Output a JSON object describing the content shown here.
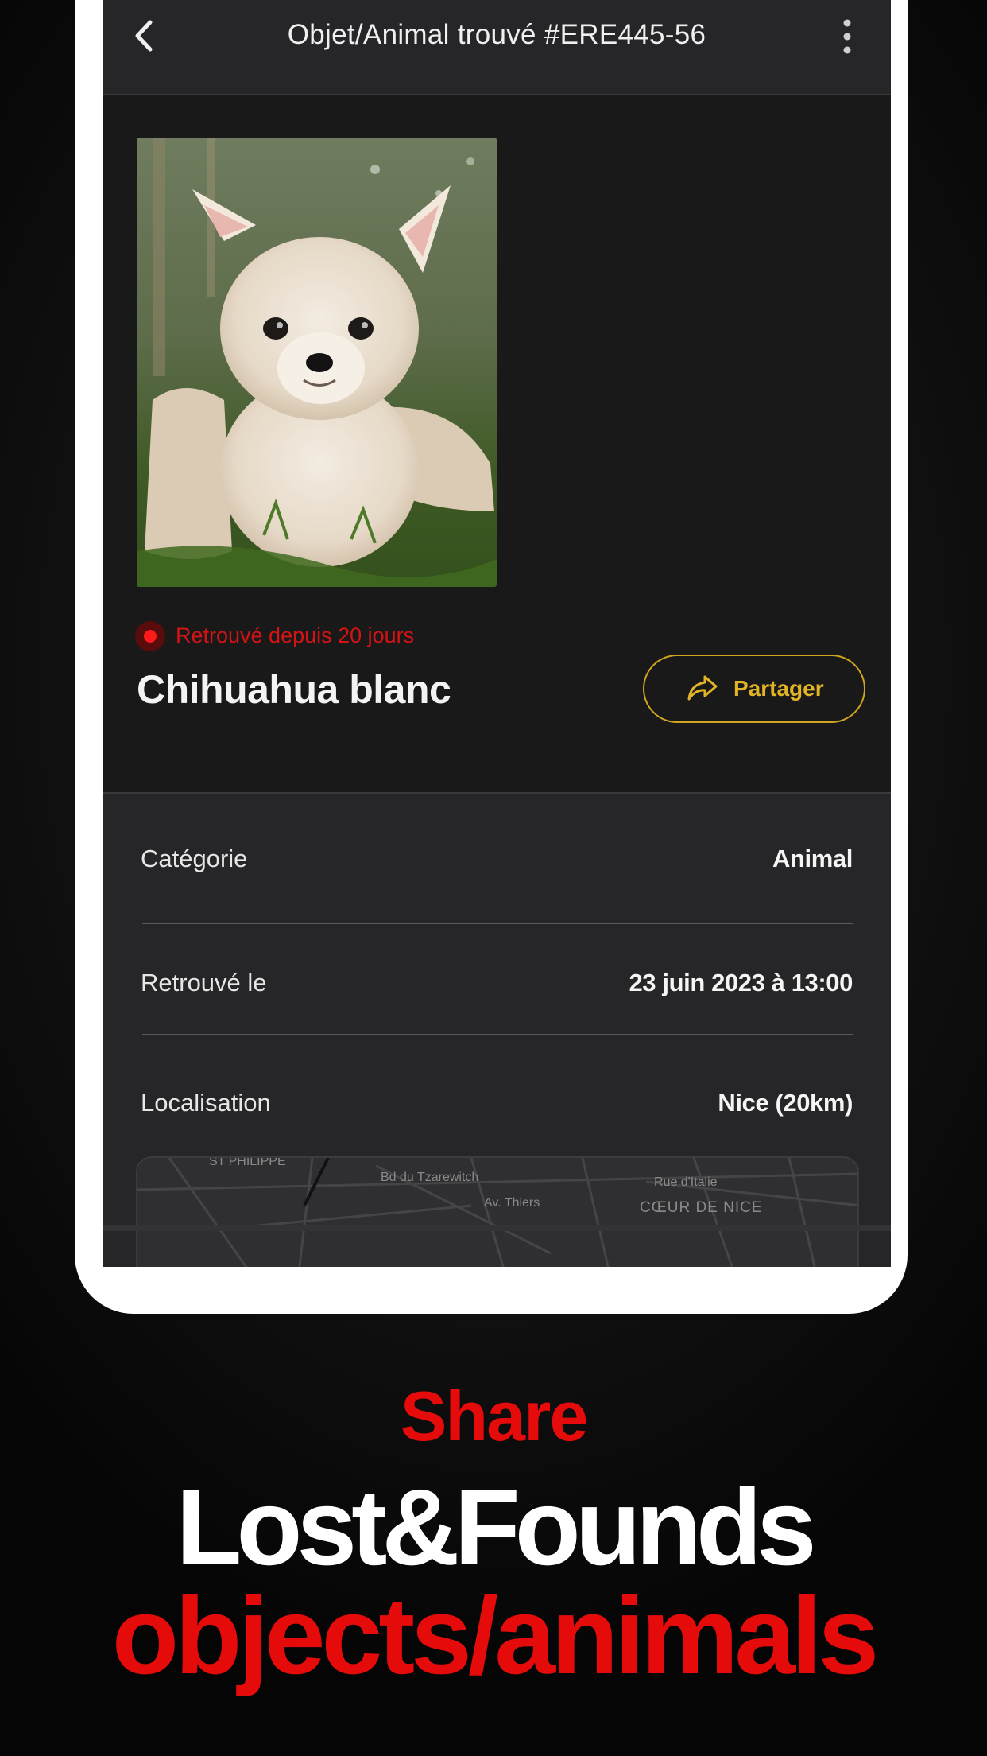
{
  "header": {
    "title": "Objet/Animal trouvé #ERE445-56",
    "back_icon": "chevron-left-icon",
    "menu_icon": "more-vertical-icon"
  },
  "item": {
    "photo_description": "chihuahua-photo",
    "status": "Retrouvé depuis 20 jours",
    "title": "Chihuahua blanc",
    "share_label": "Partager",
    "share_icon": "share-arrow-icon"
  },
  "details": {
    "rows": [
      {
        "label": "Catégorie",
        "value": "Animal"
      },
      {
        "label": "Retrouvé le",
        "value": "23 juin 2023 à 13:00"
      },
      {
        "label": "Localisation",
        "value": "Nice (20km)"
      }
    ],
    "map_labels": [
      "ST PHILIPPE",
      "Bd du Tzarewitch",
      "Av. Thiers",
      "Rue d'Italie",
      "CŒUR DE NICE"
    ]
  },
  "promo": {
    "line1": "Share",
    "line2": "Lost&Founds",
    "line3": "objects/animals"
  },
  "colors": {
    "accent_red": "#e60b0b",
    "status_red": "#d41414",
    "share_gold": "#e2b425",
    "screen_bg": "#191919",
    "panel_bg": "#262628"
  }
}
